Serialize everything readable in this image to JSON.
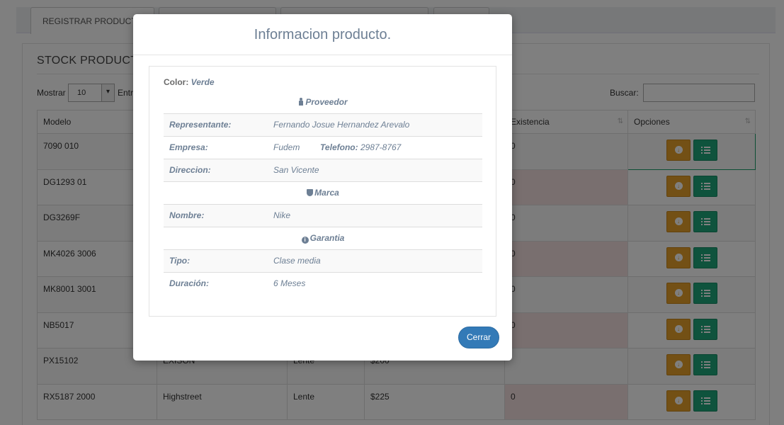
{
  "tabs": [
    {
      "label": "REGISTRAR PRODUCTO"
    },
    {
      "label": ""
    },
    {
      "label": ""
    },
    {
      "label": ""
    }
  ],
  "panel": {
    "title": "STOCK PRODUCTOS"
  },
  "controls": {
    "show_label": "Mostrar",
    "show_after": "Entr",
    "page_size": "10",
    "search_label": "Buscar:"
  },
  "table": {
    "headers": [
      "Modelo",
      "",
      "",
      "",
      "Existencia",
      "Opciones"
    ],
    "rows": [
      {
        "modelo": "7090 010",
        "marca": "",
        "tipo": "",
        "precio": "",
        "existencia": "0"
      },
      {
        "modelo": "DG1293 01",
        "marca": "",
        "tipo": "",
        "precio": "",
        "existencia": "0"
      },
      {
        "modelo": "DG3269F",
        "marca": "",
        "tipo": "",
        "precio": "",
        "existencia": "0"
      },
      {
        "modelo": "MK4026 3006",
        "marca": "",
        "tipo": "",
        "precio": "",
        "existencia": "0"
      },
      {
        "modelo": "MK8001 3001",
        "marca": "",
        "tipo": "",
        "precio": "",
        "existencia": "0"
      },
      {
        "modelo": "NB5017",
        "marca": "",
        "tipo": "",
        "precio": "",
        "existencia": "0"
      },
      {
        "modelo": "PX15102",
        "marca": "EXISON",
        "tipo": "Lente",
        "precio": "$200",
        "existencia": ""
      },
      {
        "modelo": "RX5187 2000",
        "marca": "Highstreet",
        "tipo": "Lente",
        "precio": "$225",
        "existencia": "0"
      }
    ]
  },
  "modal": {
    "title": "Informacion producto.",
    "color_label": "Color:",
    "color_value": "Verde",
    "proveedor_header": "Proveedor",
    "representante_label": "Representante:",
    "representante_value": "Fernando Josue Hernandez Arevalo",
    "empresa_label": "Empresa:",
    "empresa_value": "Fudem",
    "telefono_label": "Telefono:",
    "telefono_value": "2987-8767",
    "direccion_label": "Direccion:",
    "direccion_value": "San Vicente",
    "marca_header": "Marca",
    "nombre_label": "Nombre:",
    "nombre_value": "Nike",
    "garantia_header": "Garantia",
    "tipo_label": "Tipo:",
    "tipo_value": "Clase media",
    "duracion_label": "Duración:",
    "duracion_value": "6 Meses",
    "close_label": "Cerrar"
  },
  "colors": {
    "overlay": "#000000",
    "modal_text": "#6d7f94",
    "primary_button": "#337ab7",
    "download_button": "#e6a12b",
    "list_button": "#1fa67a",
    "existencia_bg": "#f2dede"
  }
}
